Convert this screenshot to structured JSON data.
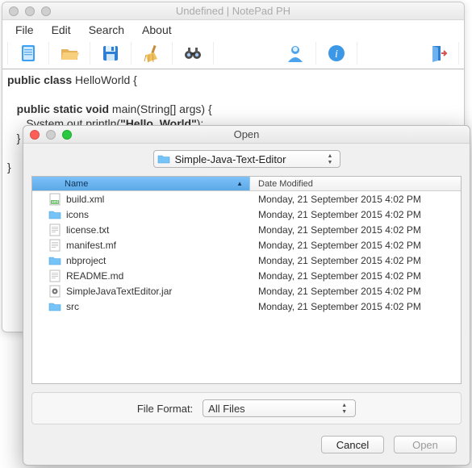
{
  "main": {
    "title": "Undefined | NotePad PH",
    "menu": [
      "File",
      "Edit",
      "Search",
      "About"
    ],
    "code_lines": [
      {
        "plain_pre": "",
        "bold": "public class",
        "plain": " HelloWorld {"
      },
      {
        "plain_pre": "",
        "bold": "",
        "plain": ""
      },
      {
        "plain_pre": "   ",
        "bold": "public static void",
        "plain": " main(String[] args) {"
      },
      {
        "plain_pre": "      System.out.println(",
        "bold": "\"Hello, World\"",
        "plain": ");"
      },
      {
        "plain_pre": "   }",
        "bold": "",
        "plain": ""
      },
      {
        "plain_pre": "",
        "bold": "",
        "plain": ""
      },
      {
        "plain_pre": "}",
        "bold": "",
        "plain": ""
      }
    ],
    "toolbar_icons": [
      "new",
      "open",
      "save",
      "clear",
      "find",
      "user",
      "info",
      "exit"
    ]
  },
  "dialog": {
    "title": "Open",
    "location": "Simple-Java-Text-Editor",
    "headers": {
      "name": "Name",
      "date": "Date Modified"
    },
    "files": [
      {
        "name": "build.xml",
        "type": "xml",
        "date": "Monday, 21 September 2015 4:02 PM"
      },
      {
        "name": "icons",
        "type": "folder",
        "date": "Monday, 21 September 2015 4:02 PM"
      },
      {
        "name": "license.txt",
        "type": "txt",
        "date": "Monday, 21 September 2015 4:02 PM"
      },
      {
        "name": "manifest.mf",
        "type": "txt",
        "date": "Monday, 21 September 2015 4:02 PM"
      },
      {
        "name": "nbproject",
        "type": "folder",
        "date": "Monday, 21 September 2015 4:02 PM"
      },
      {
        "name": "README.md",
        "type": "txt",
        "date": "Monday, 21 September 2015 4:02 PM"
      },
      {
        "name": "SimpleJavaTextEditor.jar",
        "type": "jar",
        "date": "Monday, 21 September 2015 4:02 PM"
      },
      {
        "name": "src",
        "type": "folder",
        "date": "Monday, 21 September 2015 4:02 PM"
      }
    ],
    "format_label": "File Format:",
    "format_value": "All Files",
    "buttons": {
      "cancel": "Cancel",
      "open": "Open"
    }
  }
}
